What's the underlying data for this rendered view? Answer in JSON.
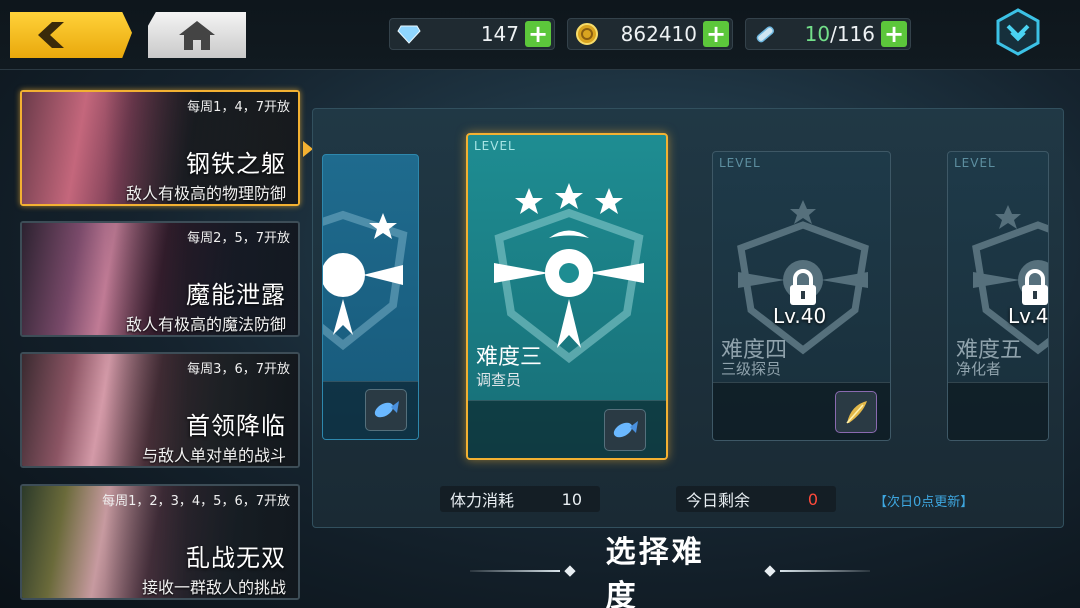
{
  "topbar": {
    "gems": "147",
    "gold": "862410",
    "stamina_current": "10",
    "stamina_sep_max": "/116"
  },
  "modes": [
    {
      "schedule": "每周1，4，7开放",
      "name": "钢铁之躯",
      "desc": "敌人有极高的物理防御",
      "active": true
    },
    {
      "schedule": "每周2，5，7开放",
      "name": "魔能泄露",
      "desc": "敌人有极高的魔法防御",
      "active": false
    },
    {
      "schedule": "每周3，6，7开放",
      "name": "首领降临",
      "desc": "与敌人单对单的战斗",
      "active": false
    },
    {
      "schedule": "每周1，2，3，4，5，6，7开放",
      "name": "乱战无双",
      "desc": "接收一群敌人的挑战",
      "active": false
    }
  ],
  "cards": {
    "level_tag": "LEVEL",
    "c3": {
      "name": "难度三",
      "sub": "调查员"
    },
    "c4": {
      "name": "难度四",
      "sub": "三级探员",
      "lock_level": "Lv.40"
    },
    "c5": {
      "name": "难度五",
      "sub": "净化者",
      "lock_level": "Lv.4"
    }
  },
  "stats": {
    "stamina_cost_label": "体力消耗",
    "stamina_cost_value": "10",
    "remaining_label": "今日剩余",
    "remaining_value": "0",
    "refresh_note": "【次日0点更新】"
  },
  "footer_title": "选择难度",
  "colors": {
    "accent": "#f3b132",
    "gold_btn": "#ffd23a",
    "plus_green": "#5cc73b",
    "remaining_red": "#ff4a3a",
    "link_blue": "#3ea7e0"
  }
}
